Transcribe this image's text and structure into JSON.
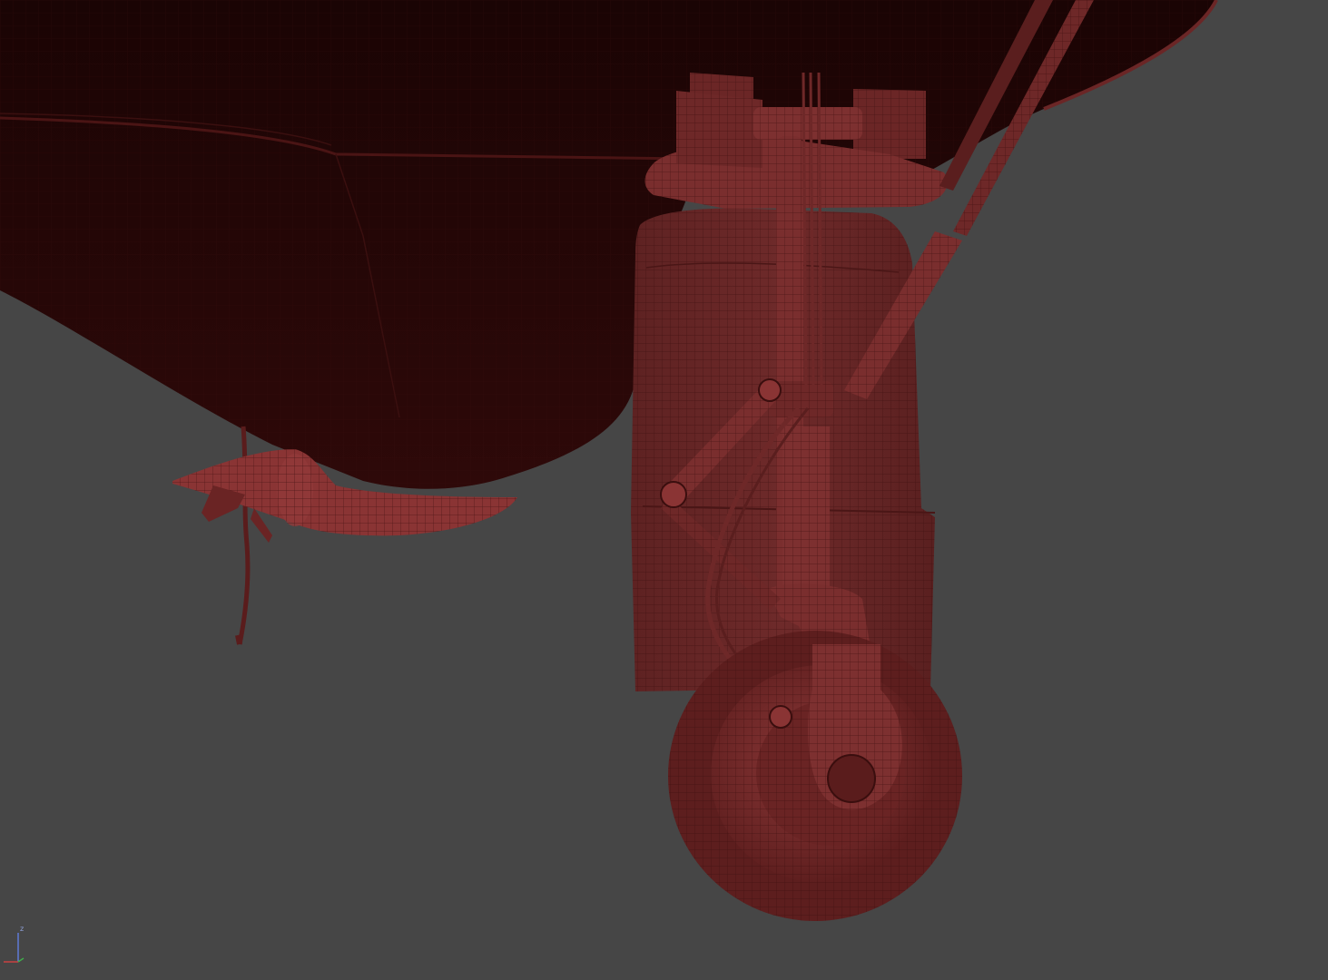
{
  "viewport": {
    "background": "#464646",
    "mesh_color": "#7a2b2b",
    "mesh_shadow_color": "#2b0b0b",
    "wire_color": "#4a1212"
  },
  "scene": {
    "objects": [
      "fuselage-underside",
      "antenna-pod",
      "antenna-wire",
      "landing-gear-door",
      "landing-gear-strut",
      "torque-link",
      "retraction-actuator",
      "brake-line",
      "main-wheel"
    ]
  },
  "axis_gizmo": {
    "z_label": "z",
    "z_color": "#5f7ad6",
    "x_color": "#c94040",
    "y_color": "#3fae4a"
  }
}
